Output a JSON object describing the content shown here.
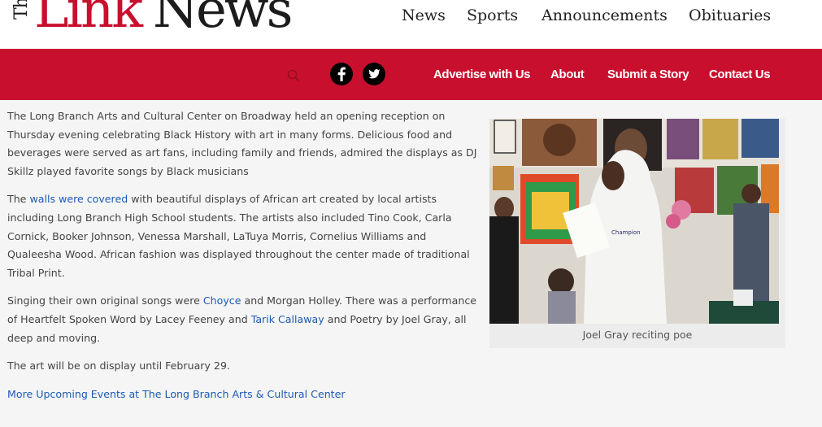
{
  "brand": {
    "the": "The",
    "link": "Link",
    "news": "News",
    "colors": {
      "red": "#c8102e",
      "dark": "#1c1c1c"
    }
  },
  "main_nav": [
    "News",
    "Sports",
    "Announcements",
    "Obituaries"
  ],
  "sub_nav": [
    "Advertise with Us",
    "About",
    "Submit a Story",
    "Contact Us"
  ],
  "icons": {
    "search": "search-icon",
    "facebook": "facebook-icon",
    "twitter": "twitter-icon"
  },
  "article": {
    "p1": "The Long Branch Arts and Cultural Center on Broadway held an opening reception on Thursday evening celebrating Black History with art in many forms. Delicious food and beverages were served as art fans, including family and friends, admired the displays as DJ Skillz played favorite songs by Black musicians",
    "p2": {
      "before": "The ",
      "link": "walls were covered",
      "after": " with beautiful displays of African art created by local artists including Long Branch High School students. The artists also included Tino Cook, Carla Cornick, Booker Johnson, Venessa Marshall, LaTuya Morris, Cornelius Williams and Qualeesha Wood. African fashion was displayed throughout the center made of traditional Tribal Print."
    },
    "p3": {
      "before": "Singing their own original songs were ",
      "link1": "Choyce",
      "middle": " and Morgan Holley.  There was a performance of Heartfelt Spoken Word by Lacey Feeney and ",
      "link2": "Tarik Callaway",
      "after": " and Poetry by Joel Gray, all deep and moving."
    },
    "p4": "The art will be on display until February 29.",
    "more_link": "More Upcoming Events at The Long Branch Arts & Cultural Center"
  },
  "figure": {
    "caption": "Joel Gray reciting poe",
    "hoodie_text": "Champion"
  }
}
